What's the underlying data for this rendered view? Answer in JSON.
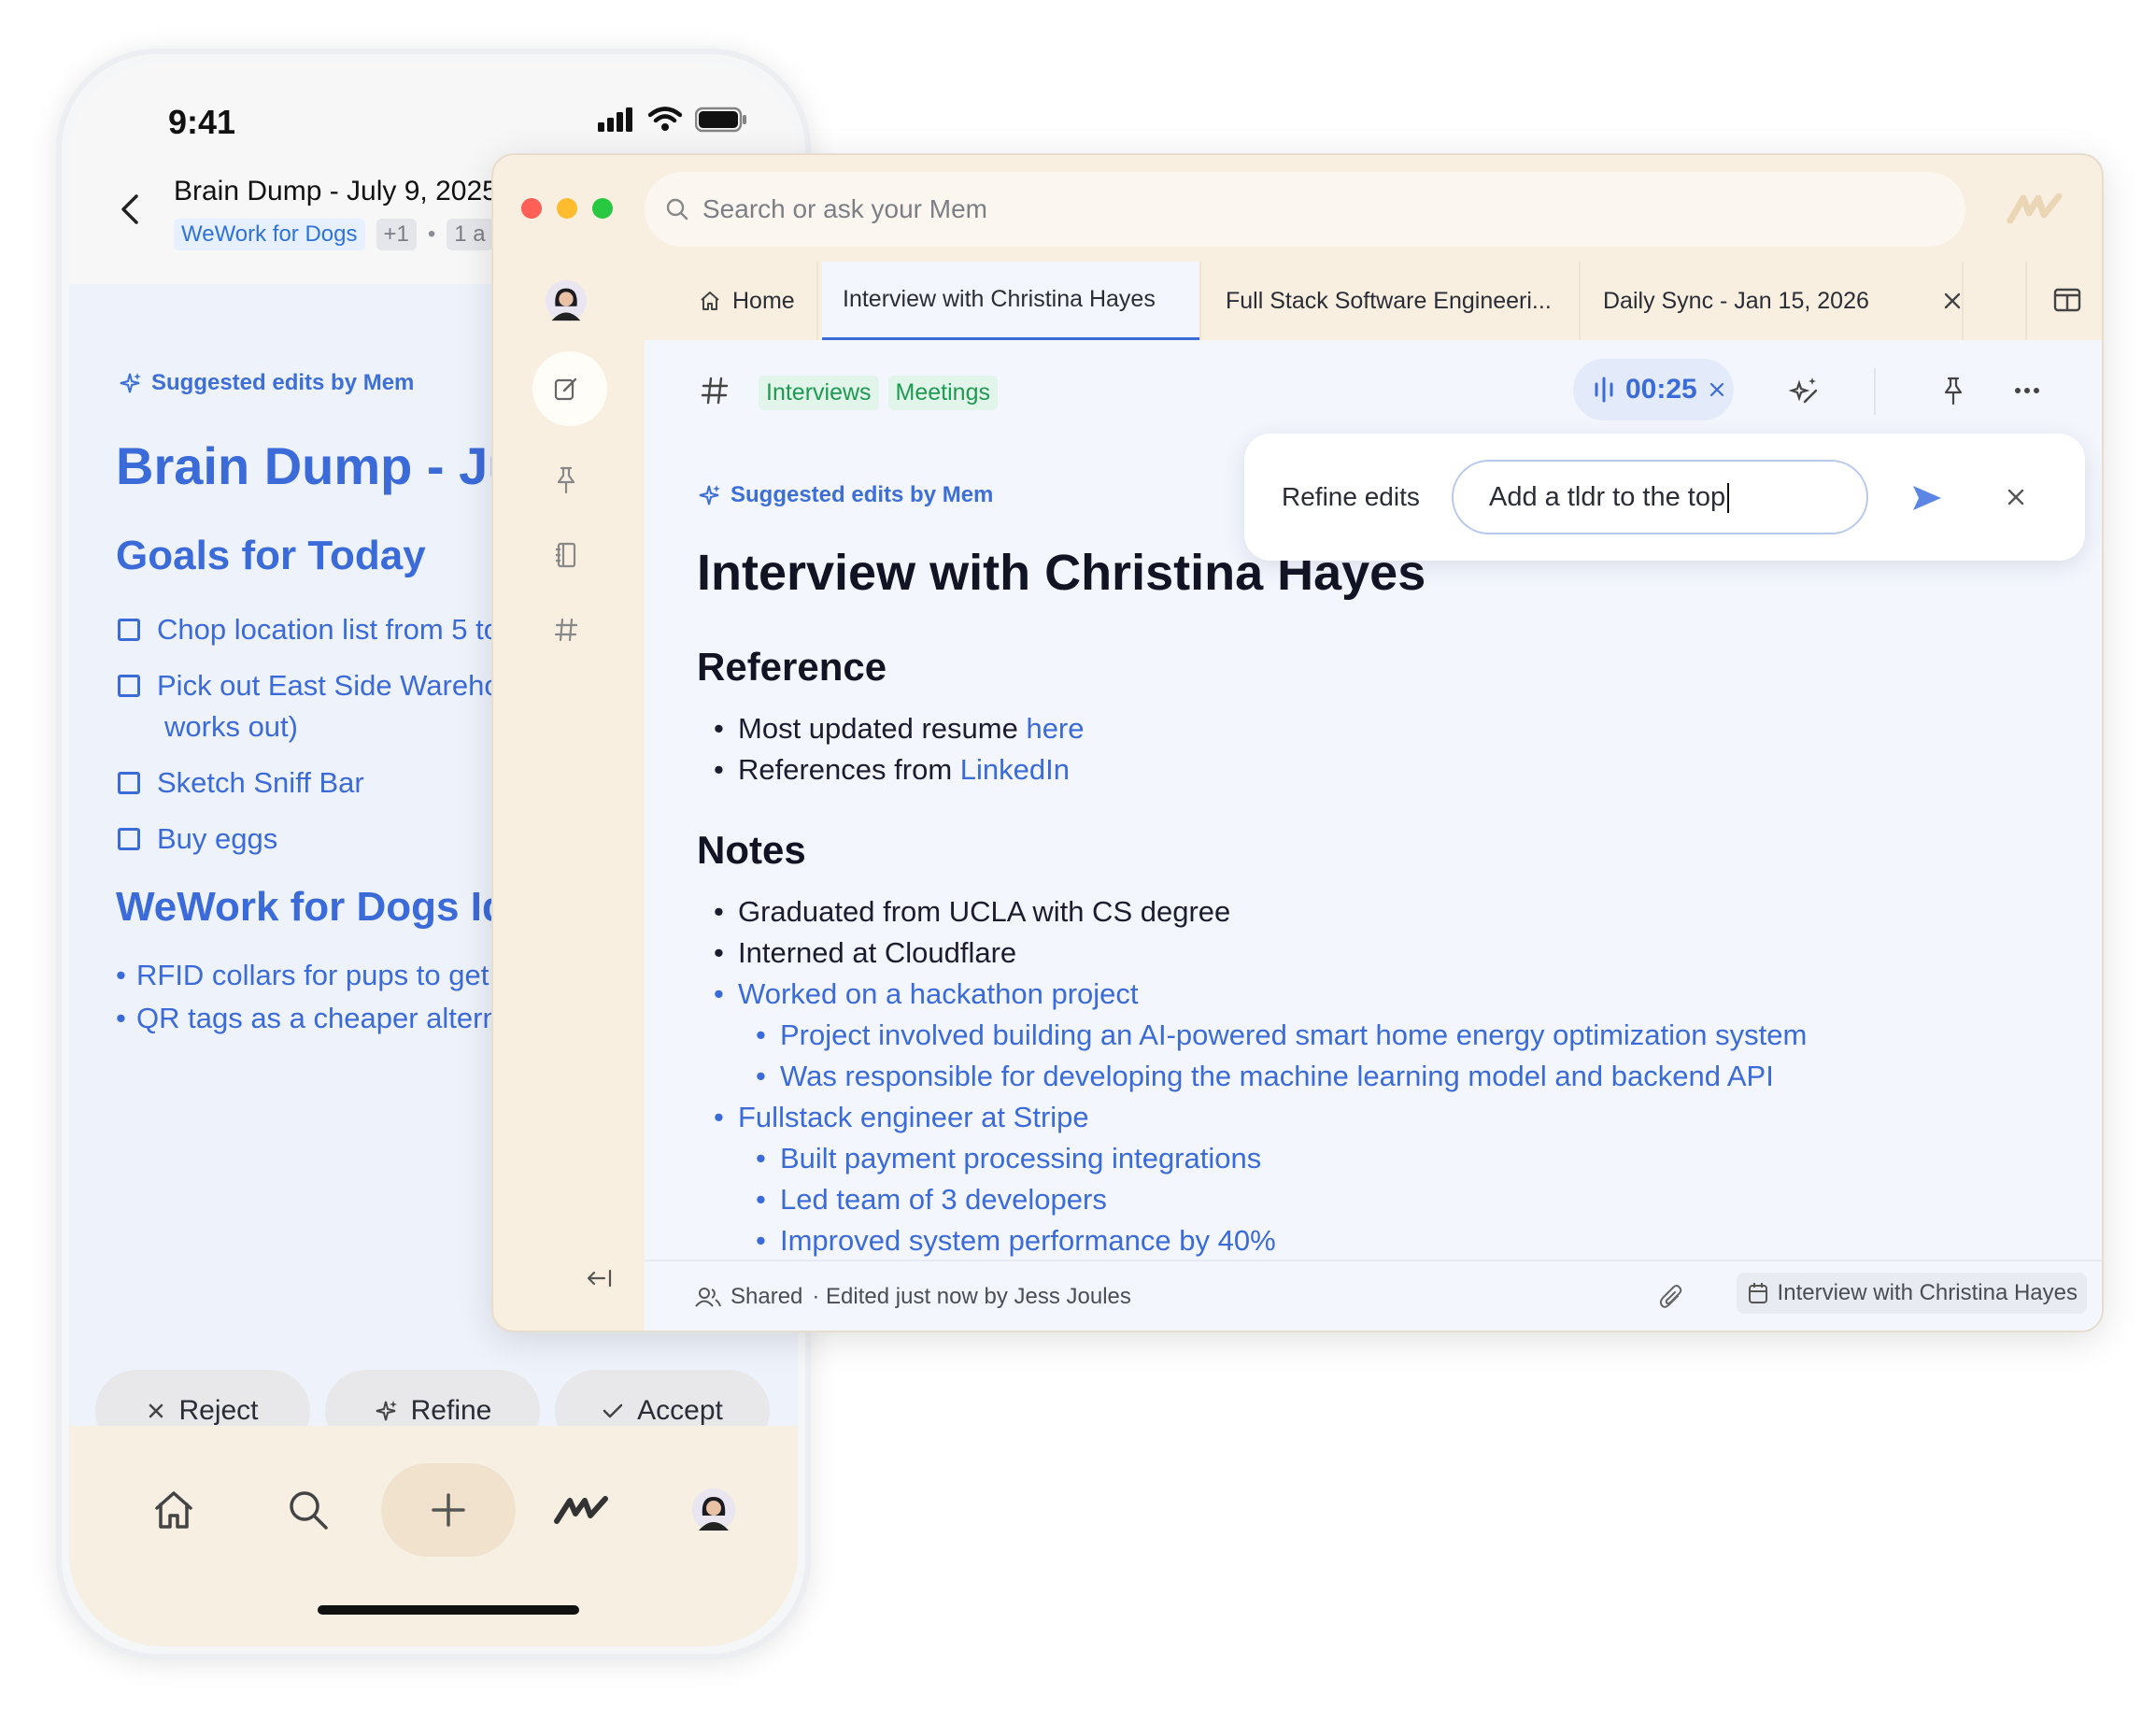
{
  "phone": {
    "status": {
      "time": "9:41"
    },
    "header": {
      "title": "Brain Dump - July 9, 2025",
      "tags": [
        "WeWork for Dogs"
      ],
      "tag_more": "+1",
      "separator": "•",
      "meta": "1 a"
    },
    "suggested_label": "Suggested edits by Mem",
    "doc_title": "Brain Dump - Ju",
    "section1": "Goals for Today",
    "checklist": [
      "Chop location list from 5 to",
      "Pick out East Side Warehou",
      "works out)",
      "Sketch Sniff Bar",
      "Buy eggs"
    ],
    "section2": "WeWork for Dogs Id",
    "bullets": [
      "RFID collars for pups to get",
      "QR tags as a cheaper altern"
    ],
    "actions": {
      "reject": "Reject",
      "refine": "Refine",
      "accept": "Accept"
    },
    "nav": [
      "home-icon",
      "search-icon",
      "plus-icon",
      "mem-logo-icon",
      "avatar"
    ]
  },
  "window": {
    "search_placeholder": "Search or ask your Mem",
    "tabs": [
      {
        "label": "Home",
        "icon": "home-icon"
      },
      {
        "label": "Interview with Christina Hayes",
        "active": true
      },
      {
        "label": "Full Stack Software Engineeri..."
      },
      {
        "label": "Daily Sync - Jan 15, 2026"
      }
    ],
    "tags": [
      "Interviews",
      "Meetings"
    ],
    "timer": "00:25",
    "refine": {
      "label": "Refine edits",
      "input_value": "Add a tldr to the top"
    },
    "suggested_label": "Suggested edits by Mem",
    "doc": {
      "title": "Interview with Christina Hayes",
      "reference_heading": "Reference",
      "reference": [
        {
          "text": "Most updated resume ",
          "link": "here"
        },
        {
          "text": "References from ",
          "link": "LinkedIn"
        }
      ],
      "notes_heading": "Notes",
      "notes": [
        "Graduated from UCLA with CS degree",
        "Interned at Cloudflare",
        "Worked on a hackathon project",
        "Project involved building an AI-powered smart home energy optimization system",
        "Was responsible for developing the machine learning model and backend API",
        "Fullstack engineer at Stripe",
        "Built payment processing integrations",
        "Led team of 3 developers",
        "Improved system performance by 40%"
      ]
    },
    "footer": {
      "shared": "Shared",
      "edited": "· Edited just now by Jess Joules",
      "chip": "Interview with Christina Hayes"
    },
    "colors": {
      "accent": "#3b6bd8",
      "sidebar": "#f9efe1",
      "tag_green": "#1f9a52"
    }
  }
}
